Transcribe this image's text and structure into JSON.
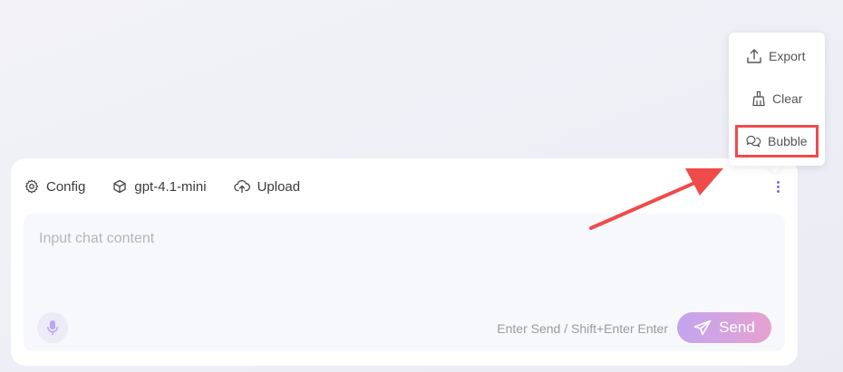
{
  "toolbar": {
    "config_label": "Config",
    "model_label": "gpt-4.1-mini",
    "upload_label": "Upload"
  },
  "input": {
    "placeholder": "Input chat content",
    "value": ""
  },
  "footer": {
    "hint": "Enter Send / Shift+Enter Enter",
    "send_label": "Send"
  },
  "menu": {
    "items": [
      {
        "label": "Export",
        "icon": "export-icon"
      },
      {
        "label": "Clear",
        "icon": "broom-icon"
      },
      {
        "label": "Bubble",
        "icon": "chat-bubble-icon"
      }
    ],
    "highlighted": "Bubble"
  },
  "colors": {
    "accent": "#7c6cf0",
    "send_gradient_start": "#c3a4f0",
    "send_gradient_end": "#e6a2d0",
    "annotation": "#ef4b4b"
  }
}
